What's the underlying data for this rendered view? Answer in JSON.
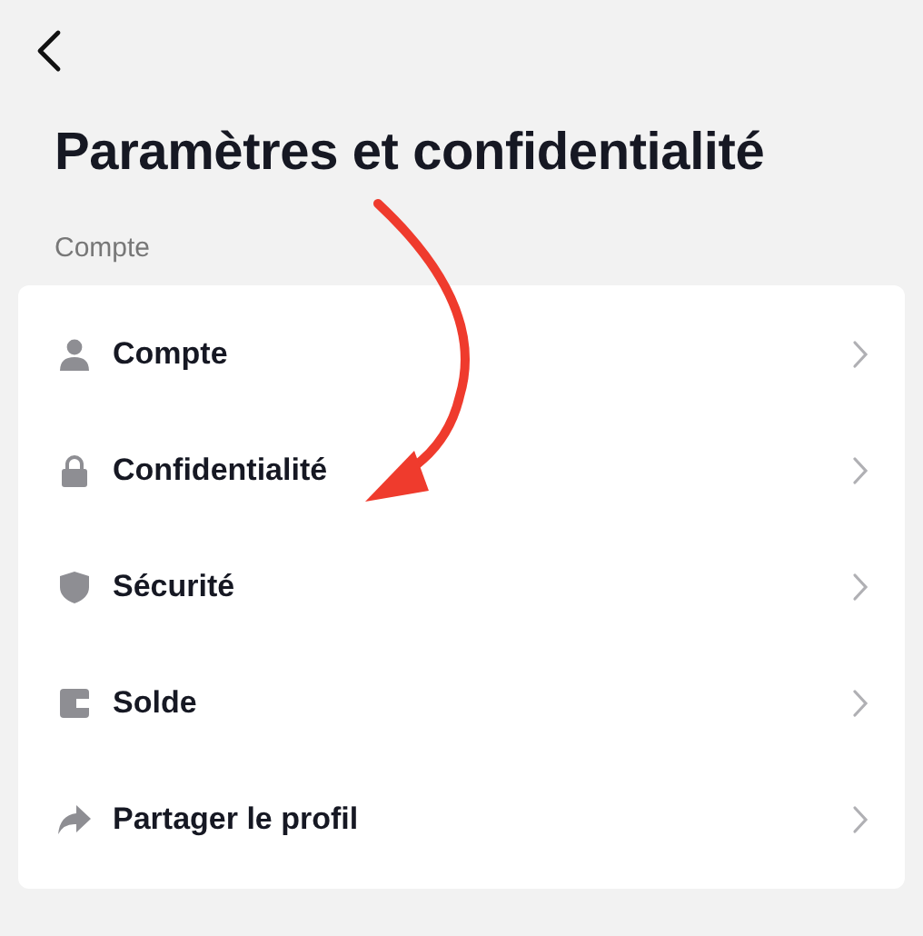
{
  "title": "Paramètres et confidentialité",
  "section": {
    "label": "Compte",
    "items": [
      {
        "kind": "person",
        "label": "Compte"
      },
      {
        "kind": "lock",
        "label": "Confidentialité"
      },
      {
        "kind": "shield",
        "label": "Sécurité"
      },
      {
        "kind": "wallet",
        "label": "Solde"
      },
      {
        "kind": "share",
        "label": "Partager le profil"
      }
    ]
  }
}
